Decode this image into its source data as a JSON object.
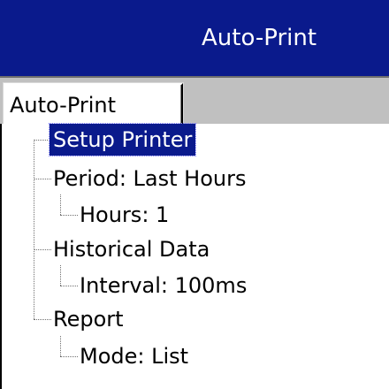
{
  "window": {
    "title": "Auto-Print",
    "titlebar_color": "#0a1a8c"
  },
  "tabs": [
    {
      "label": "Auto-Print",
      "active": true
    }
  ],
  "tree": {
    "items": [
      {
        "label": "Setup Printer",
        "level": 0,
        "selected": true
      },
      {
        "label": "Period: Last Hours",
        "level": 0,
        "selected": false
      },
      {
        "label": "Hours: 1",
        "level": 1,
        "selected": false
      },
      {
        "label": "Historical Data",
        "level": 0,
        "selected": false
      },
      {
        "label": "Interval: 100ms",
        "level": 1,
        "selected": false
      },
      {
        "label": "Report",
        "level": 0,
        "selected": false
      },
      {
        "label": "Mode: List",
        "level": 1,
        "selected": false
      }
    ]
  }
}
